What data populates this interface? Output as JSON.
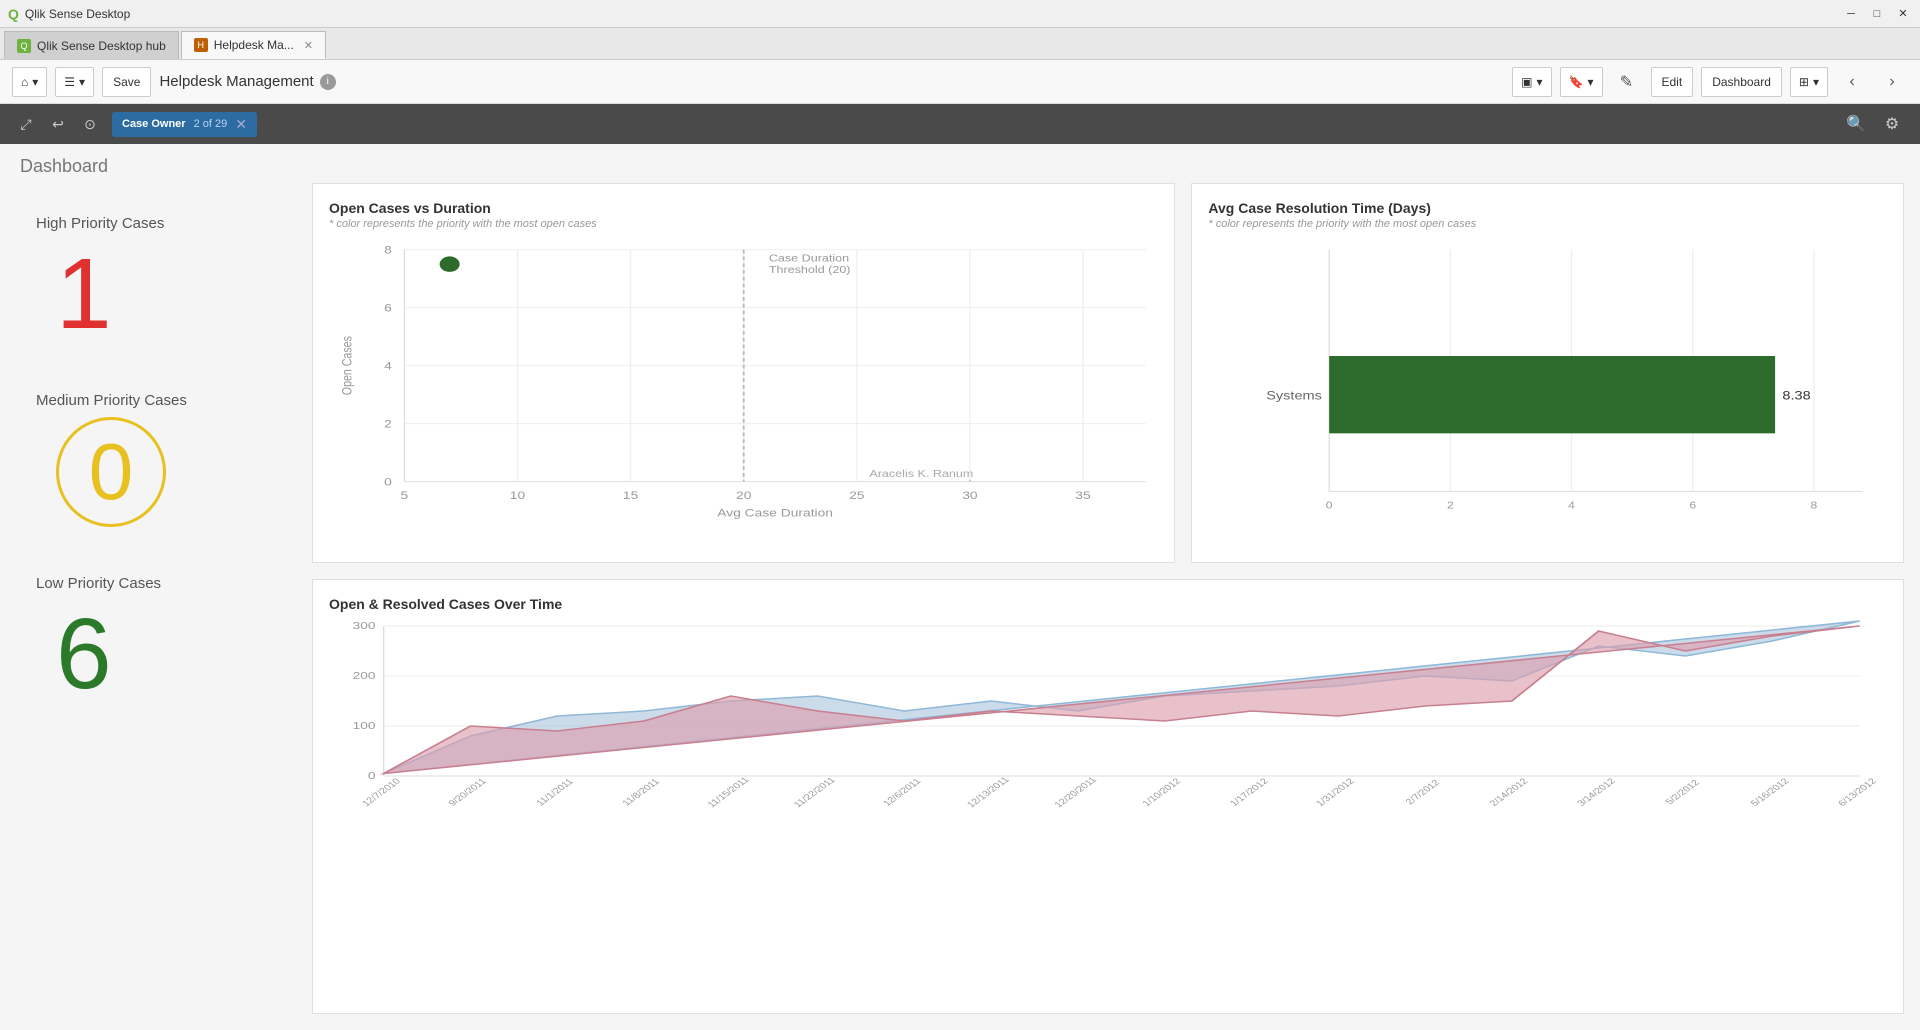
{
  "window": {
    "title": "Qlik Sense Desktop",
    "icon": "Q"
  },
  "tabs": [
    {
      "id": "hub",
      "label": "Qlik Sense Desktop hub",
      "icon": "Q",
      "active": false,
      "closable": false
    },
    {
      "id": "helpdesk",
      "label": "Helpdesk Ma...",
      "icon": "H",
      "active": true,
      "closable": true
    }
  ],
  "toolbar": {
    "save_label": "Save",
    "app_title": "Helpdesk Management",
    "edit_label": "Edit",
    "view_label": "Dashboard"
  },
  "filter_bar": {
    "chip_label": "Case Owner",
    "chip_value": "2 of 29"
  },
  "dashboard": {
    "title": "Dashboard",
    "kpis": [
      {
        "label": "High Priority Cases",
        "value": "1",
        "color": "#e03030"
      },
      {
        "label": "Medium Priority Cases",
        "value": "0",
        "color": "#e8c020"
      },
      {
        "label": "Low Priority Cases",
        "value": "6",
        "color": "#2a7a2a"
      }
    ],
    "scatter_chart": {
      "title": "Open Cases vs Duration",
      "subtitle": "* color represents the priority with the most open cases",
      "x_label": "Avg Case Duration",
      "y_label": "Open Cases",
      "threshold_label": "Case Duration Threshold (20)",
      "threshold_x": 20,
      "data_point": {
        "x": 7,
        "y": 7.5,
        "color": "#2d6b2d",
        "label": "Aracelis K. Ranum"
      },
      "label_point": {
        "x": 32,
        "y": 0,
        "label": "Aracelis K. Ranum"
      },
      "x_ticks": [
        5,
        10,
        15,
        20,
        25,
        30,
        35
      ],
      "y_ticks": [
        0,
        2,
        4,
        6,
        8
      ]
    },
    "bar_chart": {
      "title": "Avg Case Resolution Time (Days)",
      "subtitle": "* color represents the priority with the most open cases",
      "bars": [
        {
          "label": "Systems",
          "value": 8.38,
          "color": "#2d6b2d"
        }
      ]
    },
    "line_chart": {
      "title": "Open & Resolved Cases Over Time",
      "x_labels": [
        "12/7/2010",
        "9/20/2011",
        "11/1/2011",
        "11/8/2011",
        "11/15/2011",
        "11/22/2011",
        "12/6/2011",
        "12/13/2011",
        "12/20/2011",
        "1/10/2012",
        "1/17/2012",
        "1/31/2012",
        "2/7/2012",
        "2/14/2012",
        "3/14/2012",
        "5/2/2012",
        "5/16/2012",
        "6/13/2012"
      ],
      "y_ticks": [
        0,
        100,
        200,
        300
      ],
      "series": [
        {
          "name": "Open",
          "color": "rgba(180,210,240,0.7)",
          "stroke": "#a0b8d8",
          "values": [
            5,
            80,
            120,
            130,
            150,
            160,
            130,
            150,
            130,
            160,
            170,
            180,
            200,
            190,
            260,
            240,
            270,
            310
          ]
        },
        {
          "name": "Resolved",
          "color": "rgba(230,170,180,0.7)",
          "stroke": "#d88090",
          "values": [
            5,
            100,
            90,
            110,
            160,
            130,
            110,
            130,
            120,
            110,
            130,
            120,
            140,
            150,
            290,
            250,
            280,
            300
          ]
        }
      ]
    }
  },
  "icons": {
    "back": "‹",
    "forward": "›",
    "home": "⌂",
    "list": "☰",
    "select": "⬜",
    "undo": "↩",
    "lasso": "⊙",
    "pencil": "✎",
    "monitor": "▣",
    "bookmark": "🔖",
    "search": "🔍",
    "settings": "⚙",
    "close": "✕",
    "minimize": "─",
    "maximize": "□",
    "info": "i"
  }
}
